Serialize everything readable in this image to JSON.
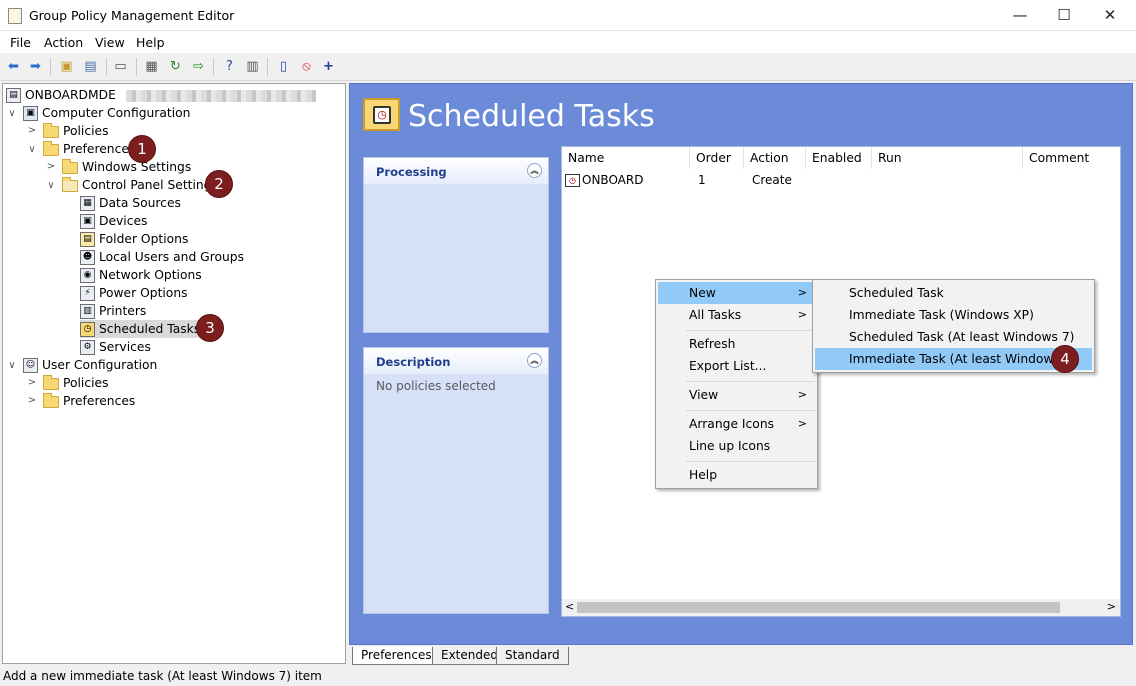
{
  "window": {
    "title": "Group Policy Management Editor",
    "minimize": "—",
    "maximize": "☐",
    "close": "✕"
  },
  "menu": [
    "File",
    "Action",
    "View",
    "Help"
  ],
  "tree": {
    "root": "ONBOARDMDE",
    "computer_config": "Computer Configuration",
    "policies": "Policies",
    "preferences": "Preferences",
    "windows_settings": "Windows Settings",
    "control_panel": "Control Panel Settings",
    "items": [
      "Data Sources",
      "Devices",
      "Folder Options",
      "Local Users and Groups",
      "Network Options",
      "Power Options",
      "Printers",
      "Scheduled Tasks",
      "Services"
    ],
    "user_config": "User Configuration",
    "user_policies": "Policies",
    "user_preferences": "Preferences"
  },
  "badges": [
    "1",
    "2",
    "3",
    "4"
  ],
  "main": {
    "title": "Scheduled Tasks",
    "processing": "Processing",
    "description": "Description",
    "description_text": "No policies selected",
    "columns": [
      "Name",
      "Order",
      "Action",
      "Enabled",
      "Run",
      "Comment"
    ],
    "rows": [
      {
        "name": "ONBOARD",
        "order": "1",
        "action": "Create"
      }
    ]
  },
  "context_menu": {
    "new": "New",
    "all_tasks": "All Tasks",
    "refresh": "Refresh",
    "export": "Export List...",
    "view": "View",
    "arrange": "Arrange Icons",
    "lineup": "Line up Icons",
    "help": "Help"
  },
  "submenu": [
    "Scheduled Task",
    "Immediate Task (Windows XP)",
    "Scheduled Task (At least Windows 7)",
    "Immediate Task (At least Windows 7)"
  ],
  "tabs": [
    "Preferences",
    "Extended",
    "Standard"
  ],
  "status": "Add a new immediate task (At least Windows 7) item"
}
